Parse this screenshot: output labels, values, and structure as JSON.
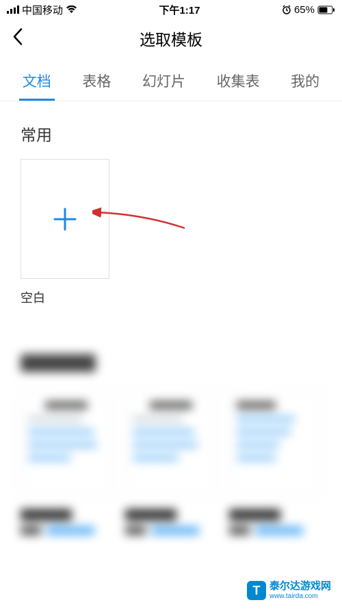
{
  "status": {
    "carrier": "中国移动",
    "time": "下午1:17",
    "battery": "65%"
  },
  "header": {
    "title": "选取模板"
  },
  "tabs": [
    {
      "label": "文档",
      "active": true
    },
    {
      "label": "表格",
      "active": false
    },
    {
      "label": "幻灯片",
      "active": false
    },
    {
      "label": "收集表",
      "active": false
    },
    {
      "label": "我的",
      "active": false
    }
  ],
  "sections": {
    "frequent": {
      "title": "常用",
      "items": [
        {
          "label": "空白",
          "type": "blank"
        }
      ]
    }
  },
  "watermark": {
    "brand": "泰尔达游戏网",
    "url": "www.tairda.com"
  }
}
